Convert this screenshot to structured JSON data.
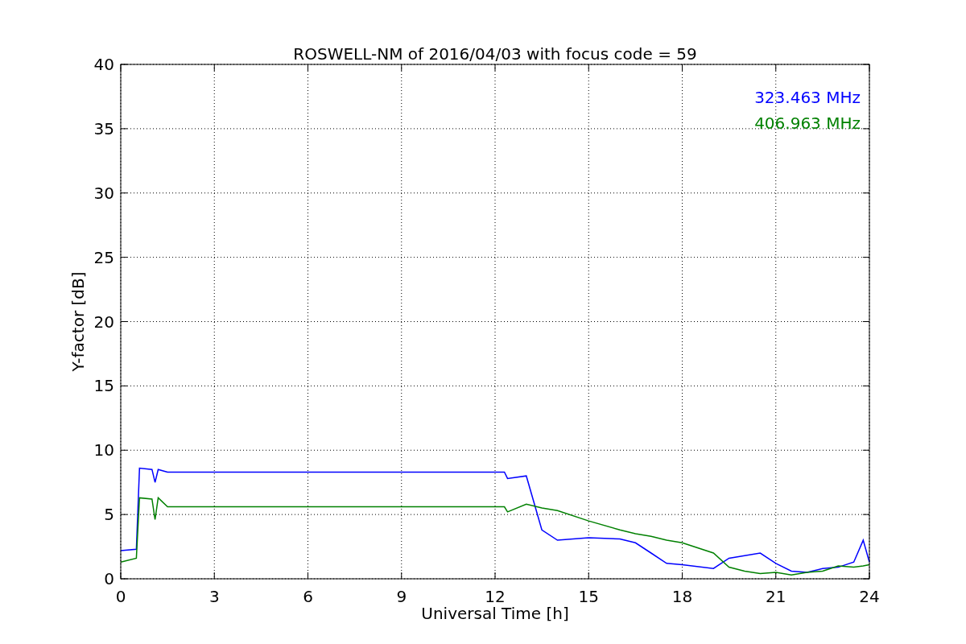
{
  "figure": {
    "chart_data": {
      "type": "line",
      "title": "ROSWELL-NM of 2016/04/03 with focus code = 59",
      "xlabel": "Universal Time [h]",
      "ylabel": "Y-factor [dB]",
      "x": [
        0,
        0.5,
        0.6,
        1.0,
        1.1,
        1.2,
        1.5,
        12.3,
        12.4,
        13,
        13.5,
        14,
        15,
        16,
        16.5,
        17,
        17.5,
        18,
        19,
        19.5,
        20,
        20.5,
        21,
        21.5,
        22,
        22.5,
        23,
        23.5,
        23.8,
        24
      ],
      "series": [
        {
          "name": "323.463 MHz",
          "color": "#0000ff",
          "values": [
            2.2,
            2.3,
            8.6,
            8.5,
            7.5,
            8.5,
            8.3,
            8.3,
            7.8,
            8.0,
            3.8,
            3.0,
            3.2,
            3.1,
            2.8,
            2.0,
            1.2,
            1.1,
            0.8,
            1.6,
            1.8,
            2.0,
            1.2,
            0.6,
            0.5,
            0.8,
            0.9,
            1.3,
            3.0,
            1.3
          ]
        },
        {
          "name": "406.963 MHz",
          "color": "#008000",
          "values": [
            1.3,
            1.6,
            6.3,
            6.2,
            4.6,
            6.3,
            5.6,
            5.6,
            5.2,
            5.8,
            5.5,
            5.3,
            4.5,
            3.8,
            3.5,
            3.3,
            3.0,
            2.8,
            2.0,
            0.9,
            0.6,
            0.4,
            0.5,
            0.3,
            0.5,
            0.6,
            1.0,
            0.9,
            1.0,
            1.1
          ]
        }
      ],
      "grid": true,
      "xlim": [
        0,
        24
      ],
      "ylim": [
        0,
        40
      ],
      "xticks": [
        0,
        3,
        6,
        9,
        12,
        15,
        18,
        21,
        24
      ],
      "yticks": [
        0,
        5,
        10,
        15,
        20,
        25,
        30,
        35,
        40
      ]
    }
  }
}
